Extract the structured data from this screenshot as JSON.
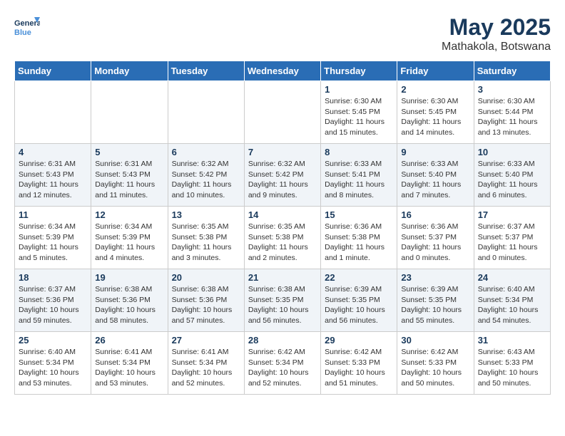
{
  "header": {
    "logo_line1": "General",
    "logo_line2": "Blue",
    "month_year": "May 2025",
    "location": "Mathakola, Botswana"
  },
  "weekdays": [
    "Sunday",
    "Monday",
    "Tuesday",
    "Wednesday",
    "Thursday",
    "Friday",
    "Saturday"
  ],
  "weeks": [
    [
      {
        "day": "",
        "info": ""
      },
      {
        "day": "",
        "info": ""
      },
      {
        "day": "",
        "info": ""
      },
      {
        "day": "",
        "info": ""
      },
      {
        "day": "1",
        "info": "Sunrise: 6:30 AM\nSunset: 5:45 PM\nDaylight: 11 hours\nand 15 minutes."
      },
      {
        "day": "2",
        "info": "Sunrise: 6:30 AM\nSunset: 5:45 PM\nDaylight: 11 hours\nand 14 minutes."
      },
      {
        "day": "3",
        "info": "Sunrise: 6:30 AM\nSunset: 5:44 PM\nDaylight: 11 hours\nand 13 minutes."
      }
    ],
    [
      {
        "day": "4",
        "info": "Sunrise: 6:31 AM\nSunset: 5:43 PM\nDaylight: 11 hours\nand 12 minutes."
      },
      {
        "day": "5",
        "info": "Sunrise: 6:31 AM\nSunset: 5:43 PM\nDaylight: 11 hours\nand 11 minutes."
      },
      {
        "day": "6",
        "info": "Sunrise: 6:32 AM\nSunset: 5:42 PM\nDaylight: 11 hours\nand 10 minutes."
      },
      {
        "day": "7",
        "info": "Sunrise: 6:32 AM\nSunset: 5:42 PM\nDaylight: 11 hours\nand 9 minutes."
      },
      {
        "day": "8",
        "info": "Sunrise: 6:33 AM\nSunset: 5:41 PM\nDaylight: 11 hours\nand 8 minutes."
      },
      {
        "day": "9",
        "info": "Sunrise: 6:33 AM\nSunset: 5:40 PM\nDaylight: 11 hours\nand 7 minutes."
      },
      {
        "day": "10",
        "info": "Sunrise: 6:33 AM\nSunset: 5:40 PM\nDaylight: 11 hours\nand 6 minutes."
      }
    ],
    [
      {
        "day": "11",
        "info": "Sunrise: 6:34 AM\nSunset: 5:39 PM\nDaylight: 11 hours\nand 5 minutes."
      },
      {
        "day": "12",
        "info": "Sunrise: 6:34 AM\nSunset: 5:39 PM\nDaylight: 11 hours\nand 4 minutes."
      },
      {
        "day": "13",
        "info": "Sunrise: 6:35 AM\nSunset: 5:38 PM\nDaylight: 11 hours\nand 3 minutes."
      },
      {
        "day": "14",
        "info": "Sunrise: 6:35 AM\nSunset: 5:38 PM\nDaylight: 11 hours\nand 2 minutes."
      },
      {
        "day": "15",
        "info": "Sunrise: 6:36 AM\nSunset: 5:38 PM\nDaylight: 11 hours\nand 1 minute."
      },
      {
        "day": "16",
        "info": "Sunrise: 6:36 AM\nSunset: 5:37 PM\nDaylight: 11 hours\nand 0 minutes."
      },
      {
        "day": "17",
        "info": "Sunrise: 6:37 AM\nSunset: 5:37 PM\nDaylight: 11 hours\nand 0 minutes."
      }
    ],
    [
      {
        "day": "18",
        "info": "Sunrise: 6:37 AM\nSunset: 5:36 PM\nDaylight: 10 hours\nand 59 minutes."
      },
      {
        "day": "19",
        "info": "Sunrise: 6:38 AM\nSunset: 5:36 PM\nDaylight: 10 hours\nand 58 minutes."
      },
      {
        "day": "20",
        "info": "Sunrise: 6:38 AM\nSunset: 5:36 PM\nDaylight: 10 hours\nand 57 minutes."
      },
      {
        "day": "21",
        "info": "Sunrise: 6:38 AM\nSunset: 5:35 PM\nDaylight: 10 hours\nand 56 minutes."
      },
      {
        "day": "22",
        "info": "Sunrise: 6:39 AM\nSunset: 5:35 PM\nDaylight: 10 hours\nand 56 minutes."
      },
      {
        "day": "23",
        "info": "Sunrise: 6:39 AM\nSunset: 5:35 PM\nDaylight: 10 hours\nand 55 minutes."
      },
      {
        "day": "24",
        "info": "Sunrise: 6:40 AM\nSunset: 5:34 PM\nDaylight: 10 hours\nand 54 minutes."
      }
    ],
    [
      {
        "day": "25",
        "info": "Sunrise: 6:40 AM\nSunset: 5:34 PM\nDaylight: 10 hours\nand 53 minutes."
      },
      {
        "day": "26",
        "info": "Sunrise: 6:41 AM\nSunset: 5:34 PM\nDaylight: 10 hours\nand 53 minutes."
      },
      {
        "day": "27",
        "info": "Sunrise: 6:41 AM\nSunset: 5:34 PM\nDaylight: 10 hours\nand 52 minutes."
      },
      {
        "day": "28",
        "info": "Sunrise: 6:42 AM\nSunset: 5:34 PM\nDaylight: 10 hours\nand 52 minutes."
      },
      {
        "day": "29",
        "info": "Sunrise: 6:42 AM\nSunset: 5:33 PM\nDaylight: 10 hours\nand 51 minutes."
      },
      {
        "day": "30",
        "info": "Sunrise: 6:42 AM\nSunset: 5:33 PM\nDaylight: 10 hours\nand 50 minutes."
      },
      {
        "day": "31",
        "info": "Sunrise: 6:43 AM\nSunset: 5:33 PM\nDaylight: 10 hours\nand 50 minutes."
      }
    ]
  ]
}
